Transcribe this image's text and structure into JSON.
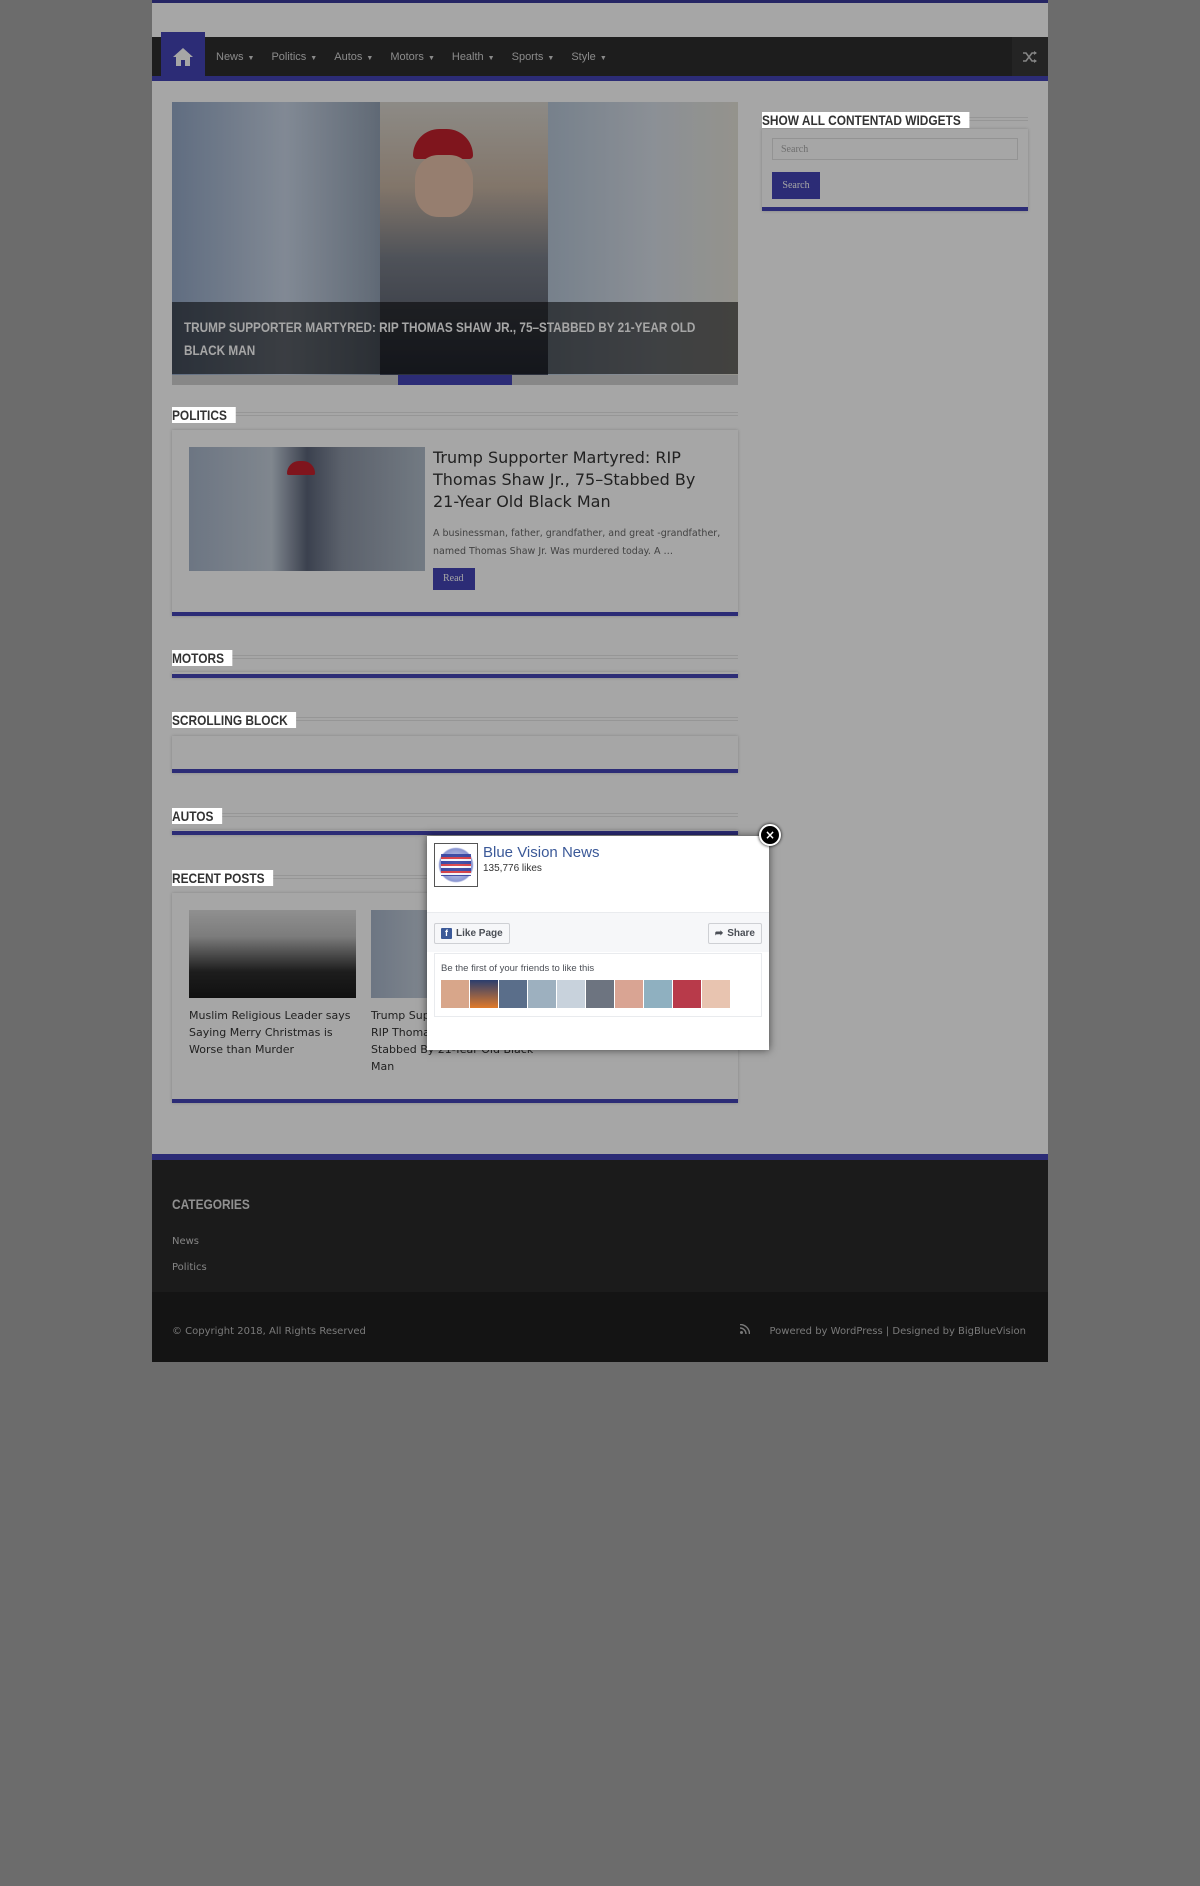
{
  "nav": {
    "items": [
      "News",
      "Politics",
      "Autos",
      "Motors",
      "Health",
      "Sports",
      "Style"
    ]
  },
  "slider": {
    "caption": "Trump Supporter Martyred: RIP Thomas Shaw Jr., 75–Stabbed By 21-Year Old Black Man"
  },
  "sections": {
    "politics": "Politics",
    "motors": "Motors",
    "scrolling": "Scrolling Block",
    "autos": "Autos",
    "recent": "Recent Posts"
  },
  "politics_post": {
    "title": "Trump Supporter Martyred: RIP Thomas Shaw Jr., 75–Stabbed By 21-Year Old Black Man",
    "excerpt": "A businessman, father, grandfather, and great -grandfather, named Thomas Shaw Jr. Was murdered today. A …",
    "read_more": "Read More »"
  },
  "recent_posts": [
    {
      "title": "Muslim Religious Leader says Saying Merry Christmas is Worse than Murder"
    },
    {
      "title": "Trump Supporter Martyred: RIP Thomas Shaw Jr., 75–Stabbed By 21-Year Old Black Man"
    }
  ],
  "sidebar": {
    "title": "Show All Contentad Widgets",
    "search_placeholder": "Search",
    "search_button": "Search"
  },
  "footer": {
    "categories_title": "Categories",
    "categories": [
      "News",
      "Politics"
    ],
    "copyright": "© Copyright 2018, All Rights Reserved",
    "powered": "Powered by WordPress | Designed by BigBlueVision"
  },
  "fb_popup": {
    "close": "×",
    "page_name": "Blue Vision News",
    "likes": "135,776 likes",
    "like_button": "Like Page",
    "share_button": "Share",
    "friends_text": "Be the first of your friends to like this"
  },
  "icons": {
    "home": "home-icon",
    "shuffle": "shuffle-icon",
    "rss": "rss-icon",
    "close": "close-icon"
  },
  "colors": {
    "accent": "#4444b5",
    "nav_bg": "#2d2d2d",
    "footer_bg": "#2a2a2a",
    "fb_blue": "#3b5998"
  }
}
